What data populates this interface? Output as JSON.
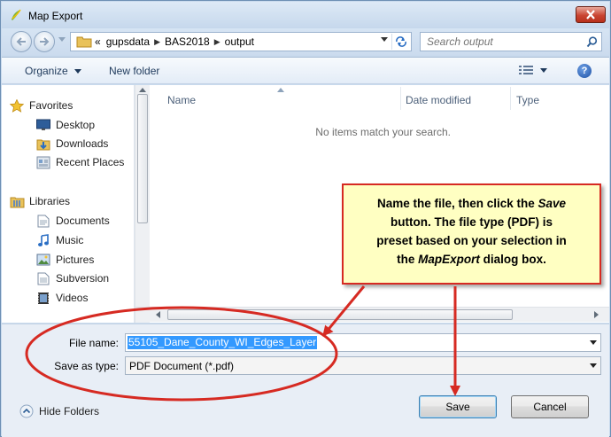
{
  "window": {
    "title": "Map Export"
  },
  "address": {
    "overflow": "«",
    "crumbs": [
      "gupsdata",
      "BAS2018",
      "output"
    ]
  },
  "search": {
    "placeholder": "Search output"
  },
  "toolbar": {
    "organize_label": "Organize",
    "new_folder_label": "New folder"
  },
  "sidebar": {
    "favorites": {
      "label": "Favorites",
      "icon": "star-icon",
      "items": [
        {
          "label": "Desktop",
          "icon": "desktop-icon"
        },
        {
          "label": "Downloads",
          "icon": "downloads-icon"
        },
        {
          "label": "Recent Places",
          "icon": "recent-places-icon"
        }
      ]
    },
    "libraries": {
      "label": "Libraries",
      "icon": "libraries-icon",
      "items": [
        {
          "label": "Documents",
          "icon": "documents-icon"
        },
        {
          "label": "Music",
          "icon": "music-icon"
        },
        {
          "label": "Pictures",
          "icon": "pictures-icon"
        },
        {
          "label": "Subversion",
          "icon": "subversion-icon"
        },
        {
          "label": "Videos",
          "icon": "videos-icon"
        }
      ]
    }
  },
  "file_list": {
    "columns": [
      "Name",
      "Date modified",
      "Type"
    ],
    "empty_message": "No items match your search."
  },
  "form": {
    "file_name_label": "File name:",
    "file_name_value": "55105_Dane_County_WI_Edges_Layer",
    "save_as_type_label": "Save as type:",
    "save_as_type_value": "PDF Document (*.pdf)"
  },
  "footer": {
    "hide_folders_label": "Hide Folders",
    "save_label": "Save",
    "cancel_label": "Cancel"
  },
  "annotation": {
    "line1_prefix": "Name the file, then click the ",
    "line1_em": "Save",
    "line2": "button. The file type (PDF) is",
    "line3": "preset based on your selection in",
    "line4_prefix": "the ",
    "line4_em": "MapExport",
    "line4_suffix": " dialog box.",
    "color": "#d62a22"
  }
}
